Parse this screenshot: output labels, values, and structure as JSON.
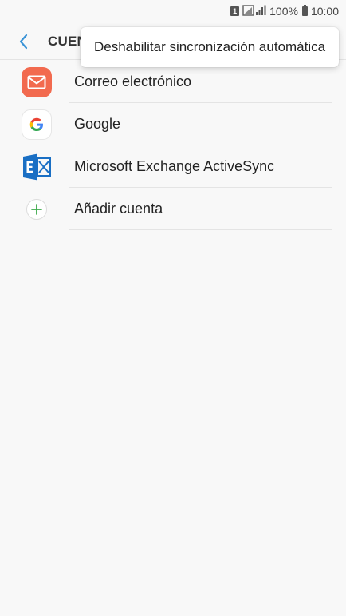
{
  "status_bar": {
    "sim_label": "1",
    "battery_percent": "100%",
    "time": "10:00",
    "icons": [
      "sim-icon",
      "signal-icon",
      "battery-icon"
    ]
  },
  "app_bar": {
    "title": "CUENT",
    "back_icon": "back-chevron-icon"
  },
  "accounts": [
    {
      "label": "Correo electrónico",
      "icon": "email-icon"
    },
    {
      "label": "Google",
      "icon": "google-icon"
    },
    {
      "label": "Microsoft Exchange ActiveSync",
      "icon": "exchange-icon"
    },
    {
      "label": "Añadir cuenta",
      "icon": "add-icon"
    }
  ],
  "popup_menu": {
    "items": [
      {
        "label": "Deshabilitar sincronización automática"
      }
    ]
  },
  "colors": {
    "background": "#f8f8f8",
    "email_icon": "#f26a4f",
    "exchange_icon": "#1a6fc4",
    "add_icon": "#3daa4a",
    "back_icon": "#3a93d6"
  }
}
